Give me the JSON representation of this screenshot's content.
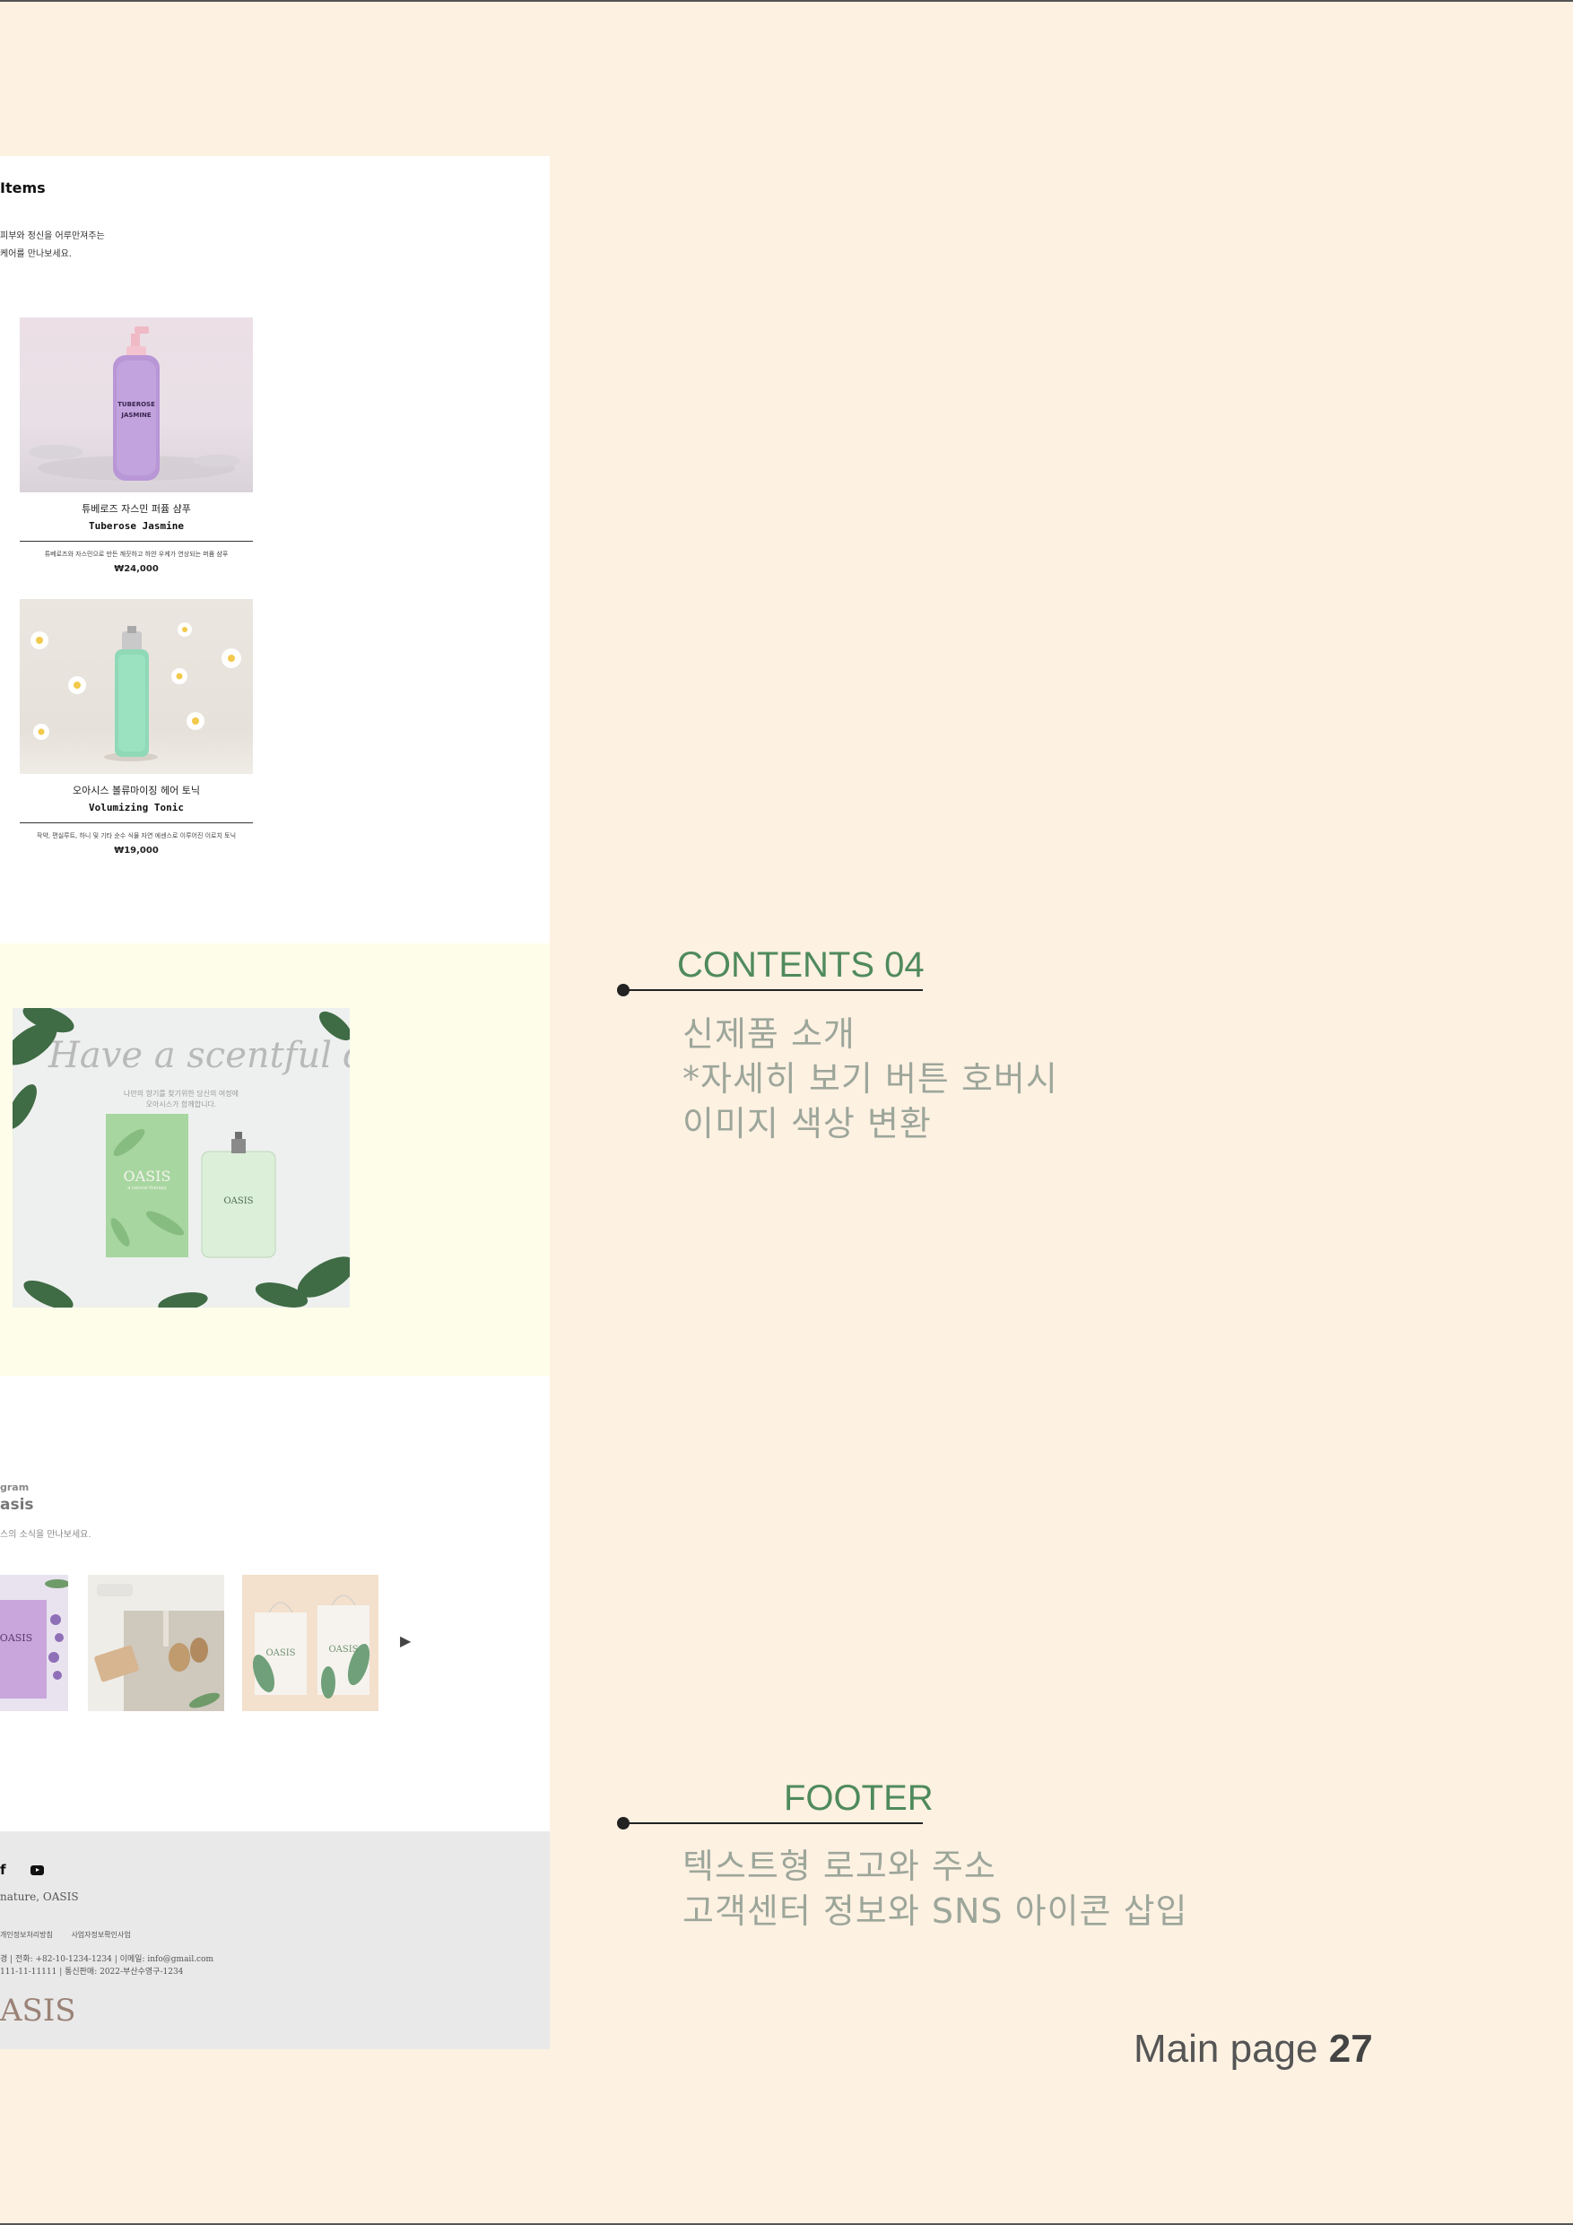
{
  "mockup": {
    "items": {
      "title": "Items",
      "desc_line1": "피부와 정신을 어루만져주는",
      "desc_line2": "케어를 만나보세요.",
      "products": [
        {
          "name_ko": "튜베로즈 자스민 퍼퓸 샴푸",
          "name_en": "Tuberose Jasmine",
          "blurb": "튜베로즈와 자스민으로 만든 깨끗하고 하얀 우케가 연상되는 퍼퓸 샴푸",
          "price": "₩24,000",
          "label_line1": "TUBEROSE",
          "label_line2": "JASMINE"
        },
        {
          "name_ko": "오아시스 볼류마이징 헤어 토닉",
          "name_en": "Volumizing Tonic",
          "blurb": "작약, 편실루트, 하니 및 기타 순수 식물 자연 에센스로 이루어진 이로치 토닉",
          "price": "₩19,000"
        }
      ]
    },
    "promo": {
      "script": "Have a scentful day",
      "sub_line1": "나만의 향기를 찾기위한 당신의 여정에",
      "sub_line2": "오아시스가 함께합니다.",
      "brand": "OASIS",
      "brand_sub": "a natural therapy"
    },
    "insta": {
      "kicker": "gram",
      "heading": "asis",
      "desc": "스의 소식을 만나보세요."
    },
    "footer": {
      "brand_line": "nature, OASIS",
      "link1": "개인정보처리방침",
      "link2": "사업자정보확인사업",
      "info_line1": "경 | 전화: +82-10-1234-1234 | 이메일: info@gmail.com",
      "info_line2": "111-11-11111 | 통신판매: 2022-부산수영구-1234",
      "logo": "ASIS"
    }
  },
  "annotations": {
    "contents04": {
      "title": "CONTENTS 04",
      "line1": "신제품 소개",
      "line2": "*자세히 보기 버튼 호버시",
      "line3": "이미지 색상 변환"
    },
    "footer": {
      "title": "FOOTER",
      "line1": "텍스트형 로고와 주소",
      "line2": "고객센터 정보와 SNS 아이콘 삽입"
    }
  },
  "page_label": {
    "prefix": "Main page",
    "number": "27"
  },
  "colors": {
    "page_bg": "#fdf1e2",
    "accent_green": "#4f8a5c",
    "annotation_text": "#9da69a",
    "promo_bg": "#fdfde9",
    "footer_bg": "#e9e9e9"
  }
}
